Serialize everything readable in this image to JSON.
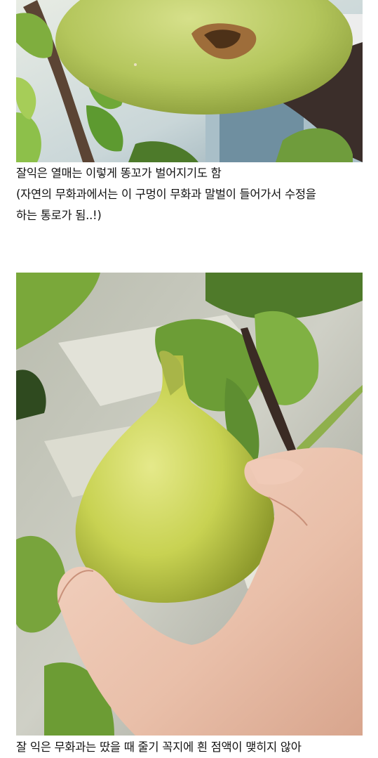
{
  "post": {
    "section1": {
      "image_alt": "fig-split-photo",
      "caption_lines": [
        "잘익은 열매는 이렇게 똥꼬가 벌어지기도 함",
        "(자연의 무화과에서는 이 구멍이 무화과 말벌이 들어가서 수정을",
        "하는 통로가 됨..!)"
      ]
    },
    "section2": {
      "image_alt": "ripe-fig-in-hand-photo",
      "caption_lines": [
        "잘 익은 무화과는 땄을 때 줄기 꼭지에 흰 점액이 맺히지 않아"
      ]
    }
  }
}
